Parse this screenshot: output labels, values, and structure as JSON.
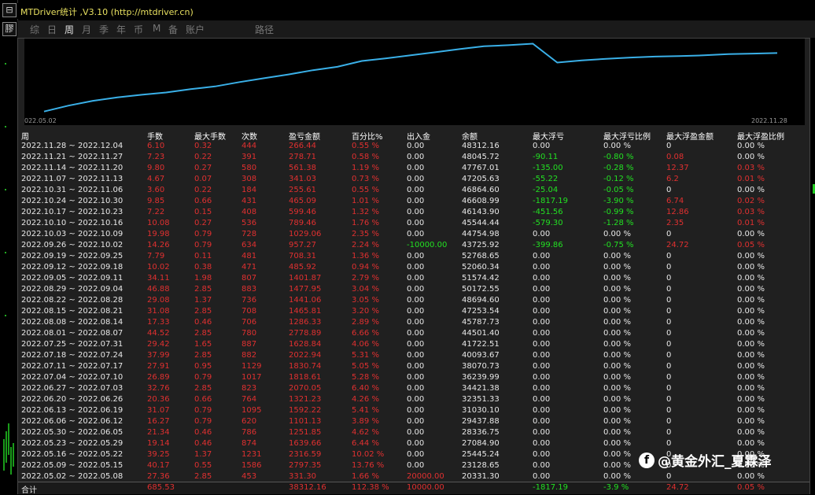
{
  "window": {
    "title": "MTDriver统计 ,V3.10 (http://mtdriver.cn)"
  },
  "strip": {
    "btn1": "⊟",
    "btn2": "膠"
  },
  "tabs": [
    {
      "label": "综",
      "active": false
    },
    {
      "label": "日",
      "active": false
    },
    {
      "label": "周",
      "active": true
    },
    {
      "label": "月",
      "active": false
    },
    {
      "label": "季",
      "active": false
    },
    {
      "label": "年",
      "active": false
    },
    {
      "label": "币",
      "active": false
    },
    {
      "label": "M",
      "active": false
    },
    {
      "label": "备",
      "active": false
    },
    {
      "label": "账户",
      "active": false
    },
    {
      "label": "路径",
      "active": false
    }
  ],
  "chart_data": {
    "type": "line",
    "x_start": "022.05.02",
    "x_end": "2022.11.28",
    "line_color": "#3ab0e8",
    "values": [
      20331.3,
      23128.65,
      25445.24,
      27084.9,
      28336.75,
      29437.88,
      31030.1,
      32351.33,
      34421.38,
      36239.99,
      38070.73,
      40093.67,
      41722.51,
      44501.4,
      45787.73,
      47253.54,
      48694.6,
      50172.55,
      51574.42,
      52060.34,
      52768.65,
      43725.92,
      44754.98,
      45544.44,
      46143.9,
      46608.99,
      46864.6,
      47205.63,
      47767.01,
      48045.72,
      48312.16
    ]
  },
  "table": {
    "headers": [
      "周",
      "手数",
      "最大手数",
      "次数",
      "盈亏金额",
      "百分比%",
      "出入金",
      "余额",
      "最大浮亏",
      "最大浮亏比例",
      "最大浮盈金额",
      "最大浮盈比例"
    ],
    "rows": [
      [
        "2022.11.28 ~ 2022.12.04",
        "6.10",
        "0.32",
        "444",
        "266.44",
        "0.55 %",
        "0.00",
        "48312.16",
        "0.00",
        "0.00 %",
        "0",
        "0.00 %"
      ],
      [
        "2022.11.21 ~ 2022.11.27",
        "7.23",
        "0.22",
        "391",
        "278.71",
        "0.58 %",
        "0.00",
        "48045.72",
        "-90.11",
        "-0.80 %",
        "0.08",
        "0.00 %"
      ],
      [
        "2022.11.14 ~ 2022.11.20",
        "9.80",
        "0.27",
        "580",
        "561.38",
        "1.19 %",
        "0.00",
        "47767.01",
        "-135.00",
        "-0.28 %",
        "12.37",
        "0.03 %"
      ],
      [
        "2022.11.07 ~ 2022.11.13",
        "4.67",
        "0.07",
        "308",
        "341.03",
        "0.73 %",
        "0.00",
        "47205.63",
        "-55.22",
        "-0.12 %",
        "6.2",
        "0.01 %"
      ],
      [
        "2022.10.31 ~ 2022.11.06",
        "3.60",
        "0.22",
        "184",
        "255.61",
        "0.55 %",
        "0.00",
        "46864.60",
        "-25.04",
        "-0.05 %",
        "0",
        "0.00 %"
      ],
      [
        "2022.10.24 ~ 2022.10.30",
        "9.85",
        "0.66",
        "431",
        "465.09",
        "1.01 %",
        "0.00",
        "46608.99",
        "-1817.19",
        "-3.90 %",
        "6.74",
        "0.02 %"
      ],
      [
        "2022.10.17 ~ 2022.10.23",
        "7.22",
        "0.15",
        "408",
        "599.46",
        "1.32 %",
        "0.00",
        "46143.90",
        "-451.56",
        "-0.99 %",
        "12.86",
        "0.03 %"
      ],
      [
        "2022.10.10 ~ 2022.10.16",
        "10.08",
        "0.27",
        "536",
        "789.46",
        "1.76 %",
        "0.00",
        "45544.44",
        "-579.30",
        "-1.28 %",
        "2.35",
        "0.01 %"
      ],
      [
        "2022.10.03 ~ 2022.10.09",
        "19.98",
        "0.79",
        "728",
        "1029.06",
        "2.35 %",
        "0.00",
        "44754.98",
        "0.00",
        "0.00 %",
        "0",
        "0.00 %"
      ],
      [
        "2022.09.26 ~ 2022.10.02",
        "14.26",
        "0.79",
        "634",
        "957.27",
        "2.24 %",
        "-10000.00",
        "43725.92",
        "-399.86",
        "-0.75 %",
        "24.72",
        "0.05 %"
      ],
      [
        "2022.09.19 ~ 2022.09.25",
        "7.79",
        "0.11",
        "481",
        "708.31",
        "1.36 %",
        "0.00",
        "52768.65",
        "0.00",
        "0.00 %",
        "0",
        "0.00 %"
      ],
      [
        "2022.09.12 ~ 2022.09.18",
        "10.02",
        "0.38",
        "471",
        "485.92",
        "0.94 %",
        "0.00",
        "52060.34",
        "0.00",
        "0.00 %",
        "0",
        "0.00 %"
      ],
      [
        "2022.09.05 ~ 2022.09.11",
        "34.11",
        "1.98",
        "807",
        "1401.87",
        "2.79 %",
        "0.00",
        "51574.42",
        "0.00",
        "0.00 %",
        "0",
        "0.00 %"
      ],
      [
        "2022.08.29 ~ 2022.09.04",
        "46.88",
        "2.85",
        "883",
        "1477.95",
        "3.04 %",
        "0.00",
        "50172.55",
        "0.00",
        "0.00 %",
        "0",
        "0.00 %"
      ],
      [
        "2022.08.22 ~ 2022.08.28",
        "29.08",
        "1.37",
        "736",
        "1441.06",
        "3.05 %",
        "0.00",
        "48694.60",
        "0.00",
        "0.00 %",
        "0",
        "0.00 %"
      ],
      [
        "2022.08.15 ~ 2022.08.21",
        "31.08",
        "2.85",
        "708",
        "1465.81",
        "3.20 %",
        "0.00",
        "47253.54",
        "0.00",
        "0.00 %",
        "0",
        "0.00 %"
      ],
      [
        "2022.08.08 ~ 2022.08.14",
        "17.33",
        "0.46",
        "706",
        "1286.33",
        "2.89 %",
        "0.00",
        "45787.73",
        "0.00",
        "0.00 %",
        "0",
        "0.00 %"
      ],
      [
        "2022.08.01 ~ 2022.08.07",
        "44.52",
        "2.85",
        "780",
        "2778.89",
        "6.66 %",
        "0.00",
        "44501.40",
        "0.00",
        "0.00 %",
        "0",
        "0.00 %"
      ],
      [
        "2022.07.25 ~ 2022.07.31",
        "29.42",
        "1.65",
        "887",
        "1628.84",
        "4.06 %",
        "0.00",
        "41722.51",
        "0.00",
        "0.00 %",
        "0",
        "0.00 %"
      ],
      [
        "2022.07.18 ~ 2022.07.24",
        "37.99",
        "2.85",
        "882",
        "2022.94",
        "5.31 %",
        "0.00",
        "40093.67",
        "0.00",
        "0.00 %",
        "0",
        "0.00 %"
      ],
      [
        "2022.07.11 ~ 2022.07.17",
        "27.91",
        "0.95",
        "1129",
        "1830.74",
        "5.05 %",
        "0.00",
        "38070.73",
        "0.00",
        "0.00 %",
        "0",
        "0.00 %"
      ],
      [
        "2022.07.04 ~ 2022.07.10",
        "26.89",
        "0.79",
        "1017",
        "1818.61",
        "5.28 %",
        "0.00",
        "36239.99",
        "0.00",
        "0.00 %",
        "0",
        "0.00 %"
      ],
      [
        "2022.06.27 ~ 2022.07.03",
        "32.76",
        "2.85",
        "823",
        "2070.05",
        "6.40 %",
        "0.00",
        "34421.38",
        "0.00",
        "0.00 %",
        "0",
        "0.00 %"
      ],
      [
        "2022.06.20 ~ 2022.06.26",
        "20.36",
        "0.66",
        "764",
        "1321.23",
        "4.26 %",
        "0.00",
        "32351.33",
        "0.00",
        "0.00 %",
        "0",
        "0.00 %"
      ],
      [
        "2022.06.13 ~ 2022.06.19",
        "31.07",
        "0.79",
        "1095",
        "1592.22",
        "5.41 %",
        "0.00",
        "31030.10",
        "0.00",
        "0.00 %",
        "0",
        "0.00 %"
      ],
      [
        "2022.06.06 ~ 2022.06.12",
        "16.27",
        "0.79",
        "620",
        "1101.13",
        "3.89 %",
        "0.00",
        "29437.88",
        "0.00",
        "0.00 %",
        "0",
        "0.00 %"
      ],
      [
        "2022.05.30 ~ 2022.06.05",
        "21.34",
        "0.46",
        "786",
        "1251.85",
        "4.62 %",
        "0.00",
        "28336.75",
        "0.00",
        "0.00 %",
        "0",
        "0.00 %"
      ],
      [
        "2022.05.23 ~ 2022.05.29",
        "19.14",
        "0.46",
        "874",
        "1639.66",
        "6.44 %",
        "0.00",
        "27084.90",
        "0.00",
        "0.00 %",
        "0",
        "0.00 %"
      ],
      [
        "2022.05.16 ~ 2022.05.22",
        "39.25",
        "1.37",
        "1231",
        "2316.59",
        "10.02 %",
        "0.00",
        "25445.24",
        "0.00",
        "0.00 %",
        "0",
        "0.00 %"
      ],
      [
        "2022.05.09 ~ 2022.05.15",
        "40.17",
        "0.55",
        "1586",
        "2797.35",
        "13.76 %",
        "0.00",
        "23128.65",
        "0.00",
        "0.00 %",
        "0",
        "0.00 %"
      ],
      [
        "2022.05.02 ~ 2022.05.08",
        "27.36",
        "2.85",
        "453",
        "331.30",
        "1.66 %",
        "20000.00",
        "20331.30",
        "0.00",
        "0.00 %",
        "0",
        "0.00 %"
      ]
    ],
    "total": [
      "合计",
      "685.53",
      "",
      "",
      "38312.16",
      "112.38 %",
      "10000.00",
      "",
      "-1817.19",
      "-3.9 %",
      "24.72",
      "0.05 %"
    ]
  },
  "watermark": {
    "logo": "f",
    "text": "@黄金外汇_夏霖泽"
  },
  "colors": {
    "red": "#e03030",
    "green": "#22e022",
    "line": "#3ab0e8"
  }
}
